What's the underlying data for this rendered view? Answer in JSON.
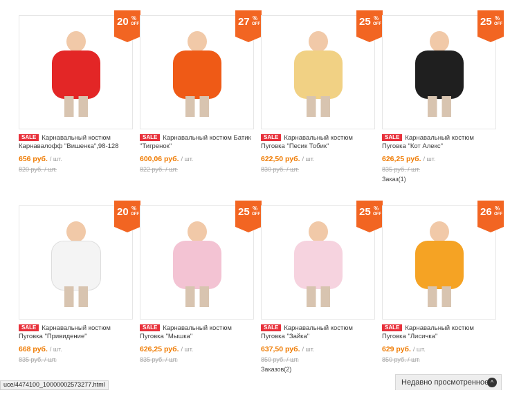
{
  "products": [
    {
      "discount_num": "20",
      "discount_pct": "%",
      "discount_off": "OFF",
      "sale_label": "SALE",
      "title_line1": "Карнавальный костюм",
      "title_line2": "Карнавалофф \"Вишенка\",98-128",
      "price": "656 руб.",
      "unit": "/ шт.",
      "old_price": "820 руб. / шт.",
      "order_text": "",
      "icon": "cherry-costume-image",
      "body_color": "#e32626"
    },
    {
      "discount_num": "27",
      "discount_pct": "%",
      "discount_off": "OFF",
      "sale_label": "SALE",
      "title_line1": "Карнавальный костюм Батик",
      "title_line2": "\"Тигренок\"",
      "price": "600,06 руб.",
      "unit": "/ шт.",
      "old_price": "822 руб. / шт.",
      "order_text": "",
      "icon": "tiger-costume-image",
      "body_color": "#ef5a16"
    },
    {
      "discount_num": "25",
      "discount_pct": "%",
      "discount_off": "OFF",
      "sale_label": "SALE",
      "title_line1": "Карнавальный костюм",
      "title_line2": "Пуговка \"Песик Тобик\"",
      "price": "622,50 руб.",
      "unit": "/ шт.",
      "old_price": "830 руб. / шт.",
      "order_text": "",
      "icon": "puppy-costume-image",
      "body_color": "#f1d184"
    },
    {
      "discount_num": "25",
      "discount_pct": "%",
      "discount_off": "OFF",
      "sale_label": "SALE",
      "title_line1": "Карнавальный костюм",
      "title_line2": "Пуговка \"Кот Алекс\"",
      "price": "626,25 руб.",
      "unit": "/ шт.",
      "old_price": "835 руб. / шт.",
      "order_text": "Заказ(1)",
      "icon": "cat-costume-image",
      "body_color": "#1f1f1f"
    },
    {
      "discount_num": "20",
      "discount_pct": "%",
      "discount_off": "OFF",
      "sale_label": "SALE",
      "title_line1": "Карнавальный костюм",
      "title_line2": "Пуговка \"Привидение\"",
      "price": "668 руб.",
      "unit": "/ шт.",
      "old_price": "835 руб. / шт.",
      "order_text": "",
      "icon": "ghost-costume-image",
      "body_color": "#f4f4f4"
    },
    {
      "discount_num": "25",
      "discount_pct": "%",
      "discount_off": "OFF",
      "sale_label": "SALE",
      "title_line1": "Карнавальный костюм",
      "title_line2": "Пуговка \"Мышка\"",
      "price": "626,25 руб.",
      "unit": "/ шт.",
      "old_price": "835 руб. / шт.",
      "order_text": "",
      "icon": "mouse-costume-image",
      "body_color": "#f3c3d3"
    },
    {
      "discount_num": "25",
      "discount_pct": "%",
      "discount_off": "OFF",
      "sale_label": "SALE",
      "title_line1": "Карнавальный костюм",
      "title_line2": "Пуговка \"Зайка\"",
      "price": "637,50 руб.",
      "unit": "/ шт.",
      "old_price": "850 руб. / шт.",
      "order_text": "Заказов(2)",
      "icon": "bunny-costume-image",
      "body_color": "#f6d3df"
    },
    {
      "discount_num": "26",
      "discount_pct": "%",
      "discount_off": "OFF",
      "sale_label": "SALE",
      "title_line1": "Карнавальный костюм",
      "title_line2": "Пуговка \"Лисичка\"",
      "price": "629 руб.",
      "unit": "/ шт.",
      "old_price": "850 руб. / шт.",
      "order_text": "",
      "icon": "fox-costume-image",
      "body_color": "#f5a324"
    }
  ],
  "status_bar": {
    "url": "uce/4474100_10000002573277.html"
  },
  "recently_viewed": {
    "label": "Недавно просмотренное",
    "chevron": "^"
  }
}
